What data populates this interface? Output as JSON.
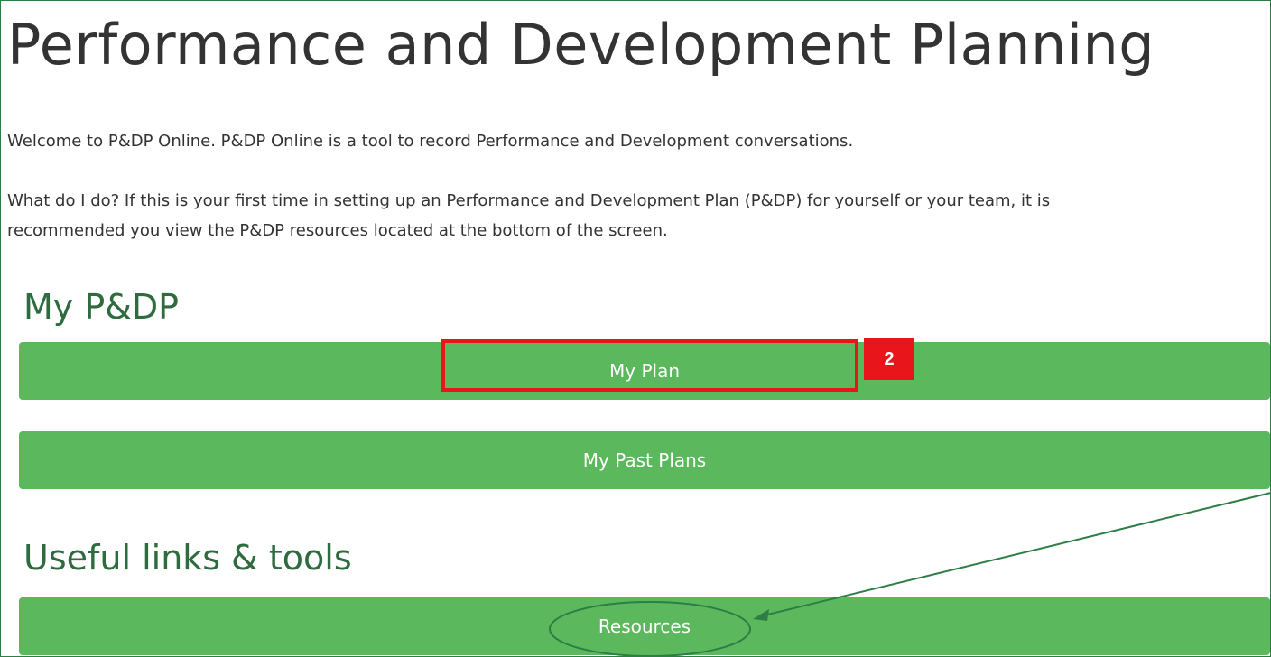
{
  "page": {
    "title": "Performance and Development Planning",
    "intro": "Welcome to P&DP Online. P&DP Online is a tool to record Performance and Development conversations.",
    "guidance_line1": "What do I do? If this is your first time in setting up an Performance and Development Plan (P&DP) for yourself or your team, it is",
    "guidance_line2": "recommended you view the P&DP resources located at the bottom of the screen."
  },
  "my_pdp": {
    "heading": "My P&DP",
    "my_plan_label": "My Plan",
    "past_plans_label": "My Past Plans"
  },
  "links": {
    "heading": "Useful links & tools",
    "resources_label": "Resources"
  },
  "annotation": {
    "step_number": "2",
    "highlight_color": "#e8161b",
    "callout_color": "#2e7d46"
  },
  "colors": {
    "button_green": "#5cb85c",
    "heading_green": "#2e6b3e",
    "text": "#333333"
  }
}
